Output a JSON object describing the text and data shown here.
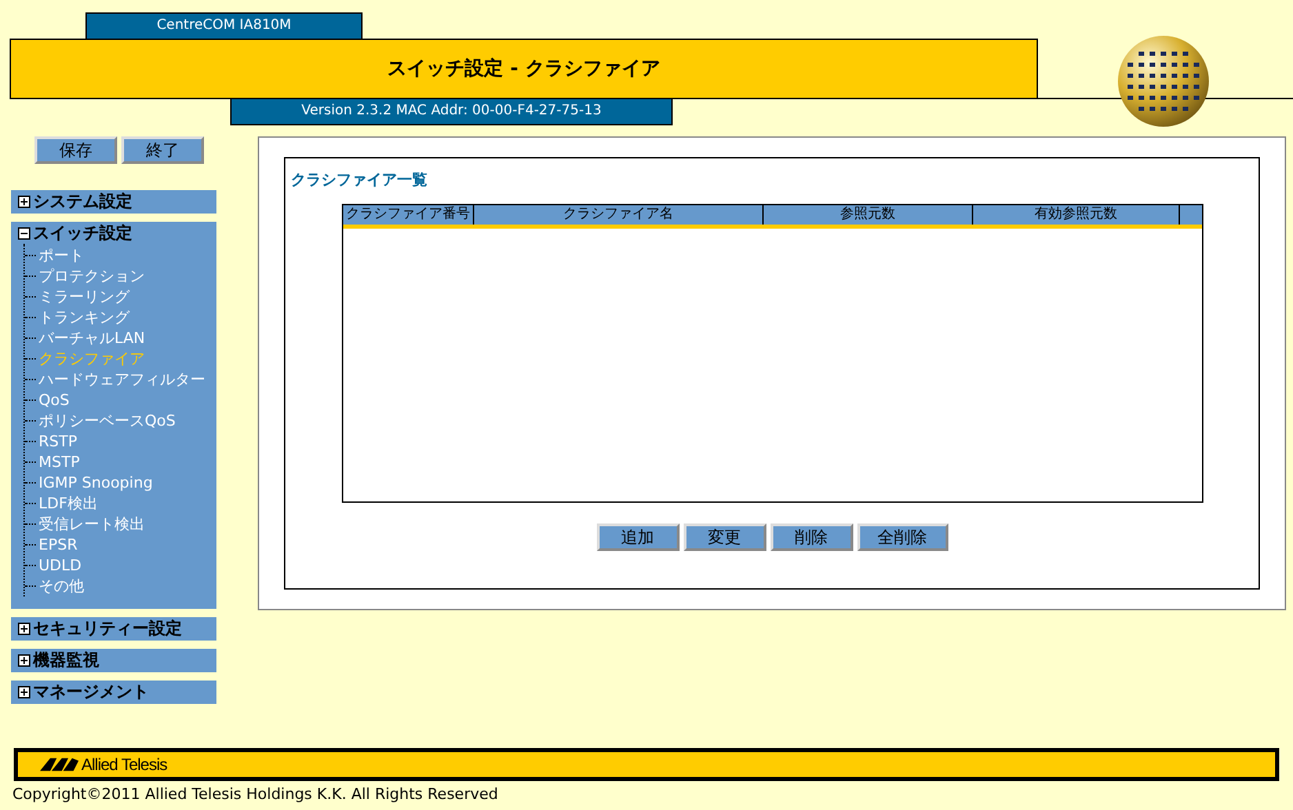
{
  "header": {
    "model": "CentreCOM IA810M",
    "title": "スイッチ設定 - クラシファイア",
    "version": "Version 2.3.2 MAC Addr: 00-00-F4-27-75-13"
  },
  "sidebar": {
    "buttons": [
      "保存",
      "終了"
    ],
    "sections": [
      {
        "label": "システム設定",
        "expanded": false
      },
      {
        "label": "スイッチ設定",
        "expanded": true,
        "children": [
          {
            "label": "ポート",
            "selected": false
          },
          {
            "label": "プロテクション",
            "selected": false
          },
          {
            "label": "ミラーリング",
            "selected": false
          },
          {
            "label": "トランキング",
            "selected": false
          },
          {
            "label": "バーチャルLAN",
            "selected": false
          },
          {
            "label": "クラシファイア",
            "selected": true
          },
          {
            "label": "ハードウェアフィルター",
            "selected": false
          },
          {
            "label": "QoS",
            "selected": false
          },
          {
            "label": "ポリシーベースQoS",
            "selected": false
          },
          {
            "label": "RSTP",
            "selected": false
          },
          {
            "label": "MSTP",
            "selected": false
          },
          {
            "label": "IGMP Snooping",
            "selected": false
          },
          {
            "label": "LDF検出",
            "selected": false
          },
          {
            "label": "受信レート検出",
            "selected": false
          },
          {
            "label": "EPSR",
            "selected": false
          },
          {
            "label": "UDLD",
            "selected": false
          },
          {
            "label": "その他",
            "selected": false
          }
        ]
      },
      {
        "label": "セキュリティー設定",
        "expanded": false
      },
      {
        "label": "機器監視",
        "expanded": false
      },
      {
        "label": "マネージメント",
        "expanded": false
      }
    ]
  },
  "panel": {
    "title": "クラシファイア一覧",
    "table": {
      "columns": [
        "クラシファイア番号",
        "クラシファイア名",
        "参照元数",
        "有効参照元数"
      ]
    },
    "buttons": [
      "追加",
      "変更",
      "削除",
      "全削除"
    ]
  },
  "footer": {
    "logo": "Allied Telesis",
    "copyright": "Copyright©2011 Allied Telesis Holdings K.K. All Rights Reserved"
  }
}
